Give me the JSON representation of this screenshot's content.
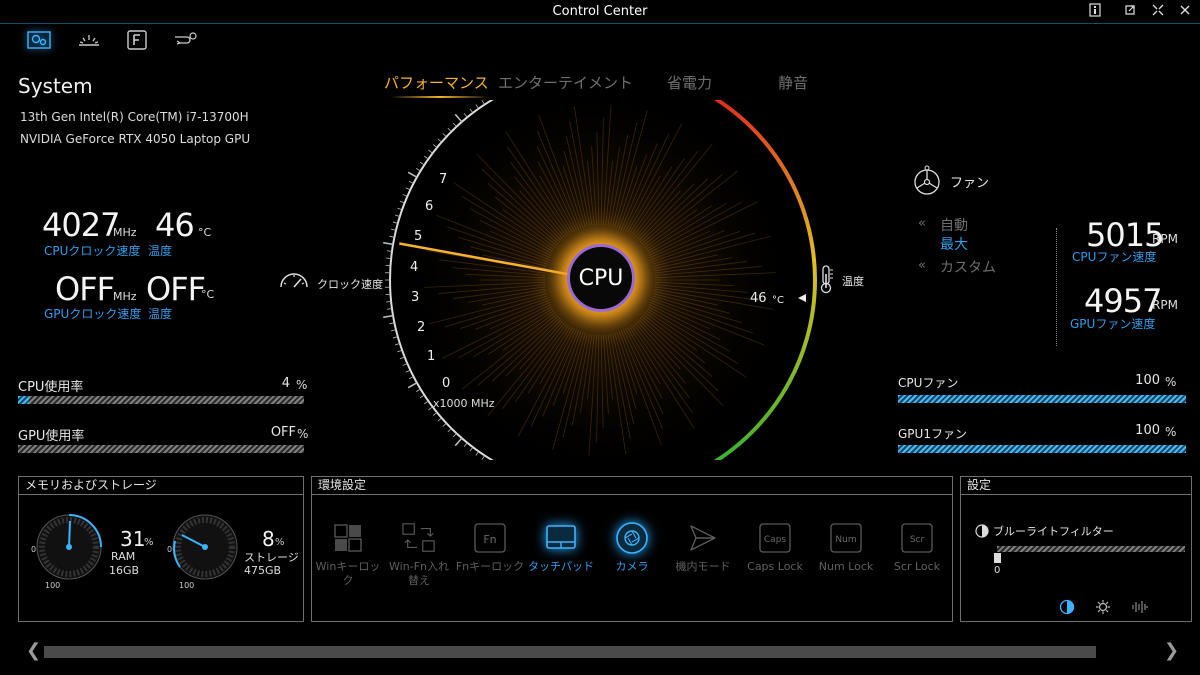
{
  "window": {
    "title": "Control Center"
  },
  "system": {
    "title": "System",
    "cpu_name": "13th Gen Intel(R) Core(TM) i7-13700H",
    "gpu_name": "NVIDIA GeForce RTX 4050 Laptop GPU",
    "cpu_clock": {
      "value": "4027",
      "unit": "MHz",
      "label": "CPUクロック速度"
    },
    "cpu_temp": {
      "value": "46",
      "unit": "°C",
      "label": "温度"
    },
    "gpu_clock": {
      "value": "OFF",
      "unit": "MHz",
      "label": "GPUクロック速度"
    },
    "gpu_temp": {
      "value": "OFF",
      "unit": "°C",
      "label": "温度"
    },
    "cpu_usage": {
      "label": "CPU使用率",
      "value": "4",
      "unit": "%",
      "percent": 4
    },
    "gpu_usage": {
      "label": "GPU使用率",
      "value": "OFF",
      "unit": "%"
    }
  },
  "modes": {
    "tabs": [
      "パフォーマンス",
      "エンターテイメント",
      "省電力",
      "静音"
    ],
    "active": "パフォーマンス"
  },
  "gauge": {
    "center_label": "CPU",
    "clock_label": "クロック速度",
    "ticks": [
      "0",
      "1",
      "2",
      "3",
      "4",
      "5",
      "6",
      "7"
    ],
    "unit_label": "x1000 MHz",
    "temp_label": "温度",
    "temp_value": "46",
    "temp_unit": "°C",
    "clock_value_khz": 4.027
  },
  "fan": {
    "title": "ファン",
    "options": [
      "自動",
      "最大",
      "カスタム"
    ],
    "active": "最大",
    "cpu_rpm": {
      "value": "5015",
      "unit": "RPM",
      "label": "CPUファン速度"
    },
    "gpu_rpm": {
      "value": "4957",
      "unit": "RPM",
      "label": "GPUファン速度"
    },
    "cpu_fan": {
      "label": "CPUファン",
      "value": "100",
      "unit": "%",
      "percent": 100
    },
    "gpu1_fan": {
      "label": "GPU1ファン",
      "value": "100",
      "unit": "%",
      "percent": 100
    }
  },
  "memory": {
    "title": "メモリおよびストレージ",
    "ram": {
      "percent": "31",
      "unit": "%",
      "label": "RAM",
      "size": "16GB"
    },
    "storage": {
      "percent": "8",
      "unit": "%",
      "label": "ストレージ",
      "size": "475GB"
    },
    "dial_min": "0",
    "dial_max": "100"
  },
  "environment": {
    "title": "環境設定",
    "tools": [
      {
        "label": "Winキーロック",
        "icon": "windows-key-icon",
        "on": false
      },
      {
        "label": "Win-Fn入れ替え",
        "icon": "swap-keys-icon",
        "on": false
      },
      {
        "label": "Fnキーロック",
        "icon": "fn-key-icon",
        "on": false
      },
      {
        "label": "タッチパッド",
        "icon": "touchpad-icon",
        "on": true
      },
      {
        "label": "カメラ",
        "icon": "camera-icon",
        "on": true
      },
      {
        "label": "機内モード",
        "icon": "airplane-icon",
        "on": false
      },
      {
        "label": "Caps Lock",
        "icon": "caps-lock-icon",
        "on": false
      },
      {
        "label": "Num Lock",
        "icon": "num-lock-icon",
        "on": false
      },
      {
        "label": "Scr Lock",
        "icon": "scroll-lock-icon",
        "on": false
      }
    ],
    "key_caps": {
      "fn": "Fn",
      "caps": "Caps",
      "num": "Num",
      "scr": "Scr"
    }
  },
  "settings": {
    "title": "設定",
    "bluelight_label": "ブルーライトフィルター",
    "bluelight_value": "0"
  },
  "colors": {
    "accent_blue": "#2d9dea",
    "accent_orange": "#f4b32b",
    "cpu_ring": "#9b6ad0"
  }
}
